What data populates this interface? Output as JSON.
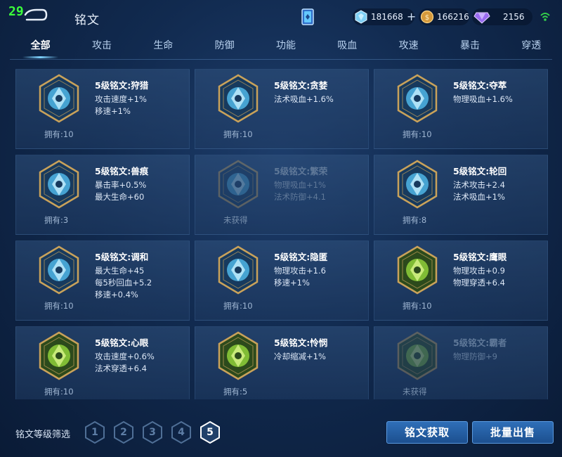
{
  "fps": "29",
  "header": {
    "title": "铭文",
    "currency": {
      "diamond": "181668",
      "gold": "166216",
      "gem": "2156"
    },
    "icons": [
      "back-icon",
      "mail-icon",
      "diamond-icon",
      "add-icon",
      "gold-coin-icon",
      "gem-icon",
      "wifi-icon"
    ]
  },
  "tabs": [
    "全部",
    "攻击",
    "生命",
    "防御",
    "功能",
    "吸血",
    "攻速",
    "暴击",
    "穿透"
  ],
  "active_tab": "全部",
  "runes": [
    {
      "name": "5级铭文:狩猎",
      "stats": [
        "攻击速度+1%",
        "移速+1%"
      ],
      "owned": "拥有:10",
      "color": "blue",
      "locked": false
    },
    {
      "name": "5级铭文:贪婪",
      "stats": [
        "法术吸血+1.6%"
      ],
      "owned": "拥有:10",
      "color": "blue",
      "locked": false
    },
    {
      "name": "5级铭文:夺萃",
      "stats": [
        "物理吸血+1.6%"
      ],
      "owned": "拥有:10",
      "color": "blue",
      "locked": false
    },
    {
      "name": "5级铭文:兽痕",
      "stats": [
        "暴击率+0.5%",
        "最大生命+60"
      ],
      "owned": "拥有:3",
      "color": "blue",
      "locked": false
    },
    {
      "name": "5级铭文:繁荣",
      "stats": [
        "物理吸血+1%",
        "法术防御+4.1"
      ],
      "owned": "未获得",
      "color": "blue",
      "locked": true
    },
    {
      "name": "5级铭文:轮回",
      "stats": [
        "法术攻击+2.4",
        "法术吸血+1%"
      ],
      "owned": "拥有:8",
      "color": "blue",
      "locked": false
    },
    {
      "name": "5级铭文:调和",
      "stats": [
        "最大生命+45",
        "每5秒回血+5.2",
        "移速+0.4%"
      ],
      "owned": "拥有:10",
      "color": "blue",
      "locked": false
    },
    {
      "name": "5级铭文:隐匿",
      "stats": [
        "物理攻击+1.6",
        "移速+1%"
      ],
      "owned": "拥有:10",
      "color": "blue",
      "locked": false
    },
    {
      "name": "5级铭文:鹰眼",
      "stats": [
        "物理攻击+0.9",
        "物理穿透+6.4"
      ],
      "owned": "拥有:10",
      "color": "green",
      "locked": false
    },
    {
      "name": "5级铭文:心眼",
      "stats": [
        "攻击速度+0.6%",
        "法术穿透+6.4"
      ],
      "owned": "拥有:10",
      "color": "green",
      "locked": false
    },
    {
      "name": "5级铭文:怜悯",
      "stats": [
        "冷却缩减+1%"
      ],
      "owned": "拥有:5",
      "color": "green",
      "locked": false
    },
    {
      "name": "5级铭文:霸者",
      "stats": [
        "物理防御+9"
      ],
      "owned": "未获得",
      "color": "green",
      "locked": true
    }
  ],
  "filter": {
    "label": "铭文等级筛选",
    "levels": [
      "1",
      "2",
      "3",
      "4",
      "5"
    ],
    "selected": "5"
  },
  "buttons": {
    "acquire": "铭文获取",
    "sell": "批量出售"
  },
  "colors": {
    "blue_rune": "#4fb6e6",
    "green_rune": "#8fd03a",
    "gold_frame": "#c9a25a",
    "button": "#2a64a8"
  }
}
